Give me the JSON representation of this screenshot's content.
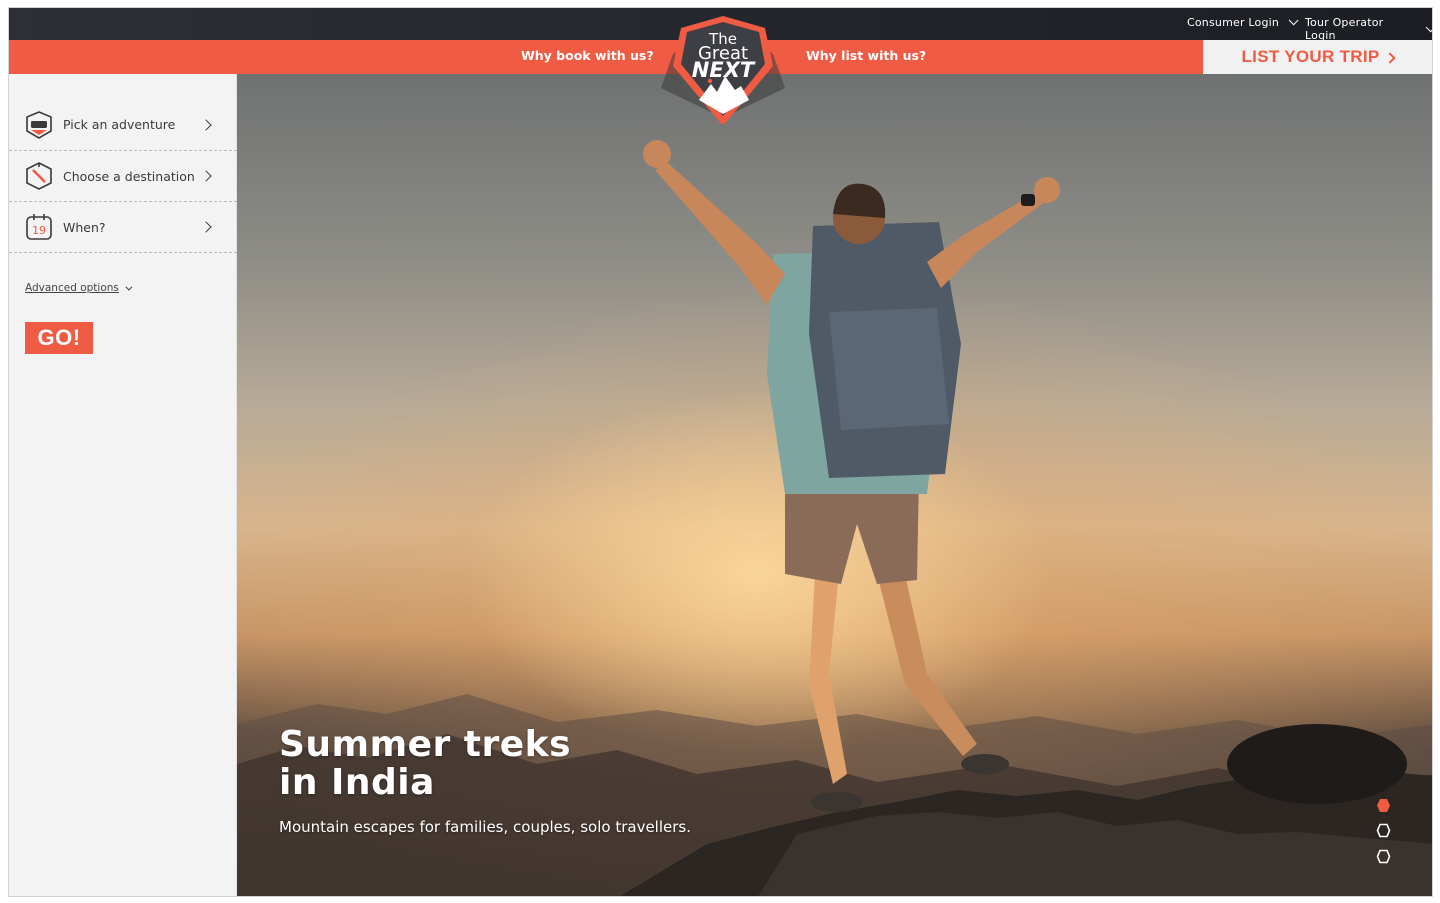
{
  "header": {
    "consumer_login": "Consumer Login",
    "operator_login": "Tour Operator Login",
    "nav_book": "Why book with us?",
    "nav_list": "Why list with us?",
    "cta_label": "LIST YOUR TRIP"
  },
  "logo": {
    "line1": "The",
    "line2": "Great",
    "line3": "NEXT"
  },
  "sidebar": {
    "items": [
      {
        "label": "Pick an adventure",
        "icon": "mask-icon"
      },
      {
        "label": "Choose a destination",
        "icon": "compass-icon"
      },
      {
        "label": "When?",
        "icon": "calendar-icon",
        "icon_text": "19"
      }
    ],
    "advanced_options": "Advanced options",
    "go_label": "GO!"
  },
  "hero": {
    "title_line1": "Summer treks",
    "title_line2": "in India",
    "subtitle": "Mountain escapes for families, couples, solo travellers.",
    "slides": {
      "active_index": 0,
      "count": 3
    }
  },
  "colors": {
    "accent": "#ef5b43",
    "dark": "#1f2128",
    "panel": "#f3f3f3"
  }
}
